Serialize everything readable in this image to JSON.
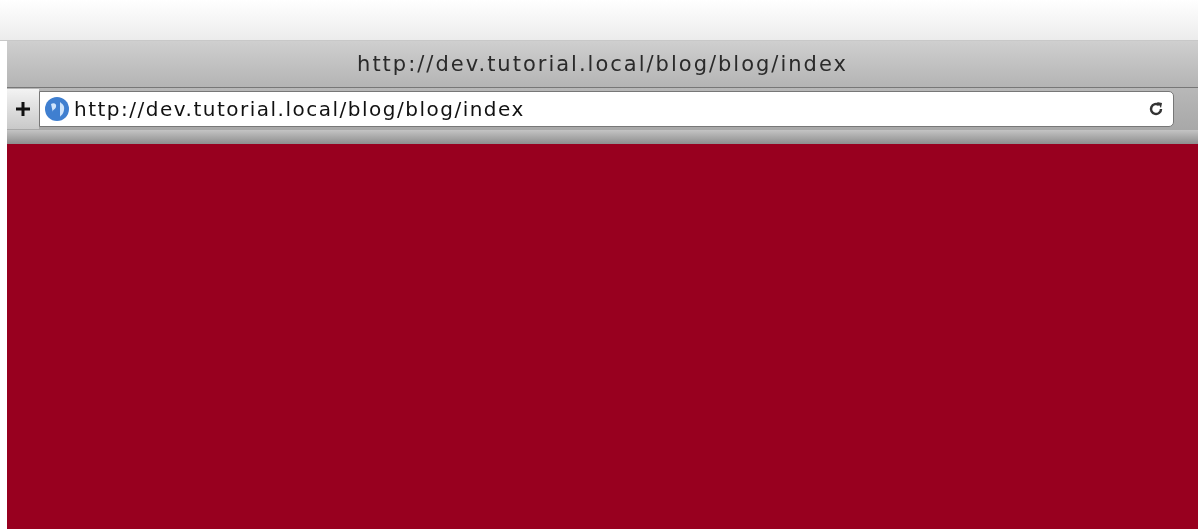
{
  "window": {
    "title": "http://dev.tutorial.local/blog/blog/index"
  },
  "address_bar": {
    "value": "http://dev.tutorial.local/blog/blog/index"
  },
  "page": {
    "kind": "blank"
  }
}
